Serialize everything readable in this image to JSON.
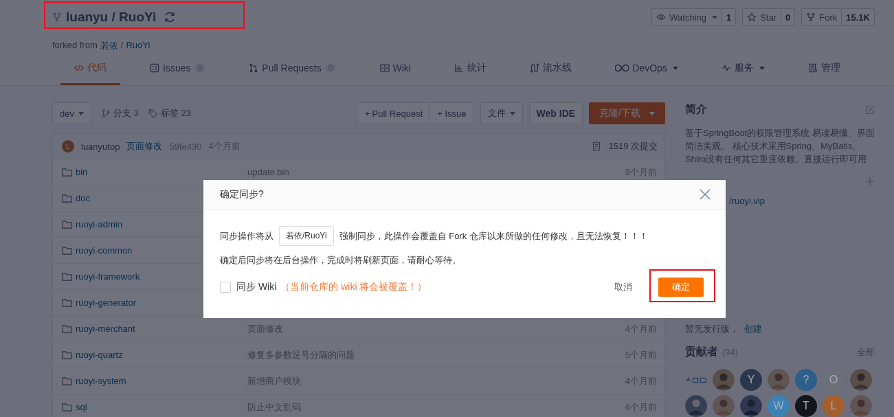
{
  "repo": {
    "owner": "luanyu",
    "separator": "/",
    "name": "RuoYi",
    "highlighted": true
  },
  "forked_from": {
    "label": "forked from",
    "owner": "若依",
    "separator": "/",
    "name": "RuoYi"
  },
  "repo_actions": [
    {
      "kind": "watch",
      "label": "Watching",
      "dropdown": true,
      "count": "1"
    },
    {
      "kind": "star",
      "label": "Star",
      "dropdown": false,
      "count": "0"
    },
    {
      "kind": "fork",
      "label": "Fork",
      "dropdown": false,
      "count": "15.1K"
    }
  ],
  "tabs": [
    {
      "kind": "code",
      "label": "代码",
      "selected": true,
      "dropdown": false
    },
    {
      "kind": "issues",
      "label": "Issues",
      "count": "0",
      "selected": false,
      "dropdown": false
    },
    {
      "kind": "pulls",
      "label": "Pull Requests",
      "count": "0",
      "selected": false,
      "dropdown": false
    },
    {
      "kind": "wiki",
      "label": "Wiki",
      "selected": false,
      "dropdown": false
    },
    {
      "kind": "stats",
      "label": "统计",
      "selected": false,
      "dropdown": false
    },
    {
      "kind": "pipeline",
      "label": "流水线",
      "selected": false,
      "dropdown": false
    },
    {
      "kind": "devops",
      "label": "DevOps",
      "selected": false,
      "dropdown": true
    },
    {
      "kind": "service",
      "label": "服务",
      "selected": false,
      "dropdown": true
    },
    {
      "kind": "manage",
      "label": "管理",
      "selected": false,
      "dropdown": false
    }
  ],
  "toolbar": {
    "branch": "dev",
    "branches": "分支 3",
    "tags": "标签 23",
    "buttons": [
      {
        "kind": "group",
        "label": "+ Pull Request"
      },
      {
        "kind": "group",
        "label": "+ Issue"
      },
      {
        "kind": "dropdown",
        "label": "文件"
      },
      {
        "kind": "bold",
        "label": "Web IDE"
      },
      {
        "kind": "primary",
        "label": "克隆/下载"
      }
    ]
  },
  "latest_commit": {
    "avatar": "L",
    "author": "luanyutop",
    "message": "页面修改",
    "hash": "59fe430",
    "time": "4个月前",
    "commits": "1519 次提交"
  },
  "files": [
    {
      "name": "bin",
      "message": "update bin",
      "time": "9个月前"
    },
    {
      "name": "doc"
    },
    {
      "name": "ruoyi-admin"
    },
    {
      "name": "ruoyi-common"
    },
    {
      "name": "ruoyi-framework"
    },
    {
      "name": "ruoyi-generator"
    },
    {
      "name": "ruoyi-merchant",
      "message": "页面修改",
      "time": "4个月前"
    },
    {
      "name": "ruoyi-quartz",
      "message": "修复多参数逗号分隔的问题",
      "time": "5个月前"
    },
    {
      "name": "ruoyi-system",
      "message": "新增商户模块",
      "time": "4个月前"
    },
    {
      "name": "sql",
      "message": "防止中文乱码",
      "time": "6个月前"
    }
  ],
  "sidebar": {
    "about_title": "简介",
    "description": "基于SpringBoot的权限管理系统 易读易懂、界面简洁美观。 核心技术采用Spring、MyBatis、Shiro没有任何其它重度依赖。直接运行即可用",
    "link": "/ruoyi.vip",
    "releases_text": "暂无发行版，",
    "releases_link": "创建",
    "contributors_title": "贡献者",
    "contributors_count": "(94)",
    "contributors_all": "全部",
    "contributors": [
      {
        "kind": "logo"
      },
      {
        "kind": "picture"
      },
      {
        "kind": "letter",
        "letter": "Y",
        "color": "#2c374d"
      },
      {
        "kind": "picture"
      },
      {
        "kind": "letter",
        "letter": "?",
        "color": "#2c5f8a"
      },
      {
        "kind": "letter",
        "letter": "O",
        "color": "#6c7079"
      },
      {
        "kind": "picture"
      },
      {
        "kind": "picture"
      },
      {
        "kind": "picture"
      },
      {
        "kind": "picture"
      },
      {
        "kind": "letter",
        "letter": "W",
        "color": "#3c82b4"
      },
      {
        "kind": "letter",
        "letter": "T",
        "color": "#14161d"
      },
      {
        "kind": "letter",
        "letter": "L",
        "color": "#a55f2d"
      },
      {
        "kind": "picture"
      }
    ]
  },
  "dialog": {
    "title": "确定同步?",
    "text_before": "同步操作将从",
    "source": "若依/RuoYi",
    "text_after": "强制同步，此操作会覆盖自 Fork 仓库以来所做的任何修改，且无法恢复！！！",
    "note": "确定后同步将在后台操作，完成时将刷新页面，请耐心等待。",
    "sync_wiki": {
      "label": "同步 Wiki",
      "checked": false
    },
    "warning": "（当前仓库的 wiki 将会被覆盖！）",
    "cancel": "取消",
    "confirm": {
      "label": "确定",
      "highlighted": true
    }
  }
}
